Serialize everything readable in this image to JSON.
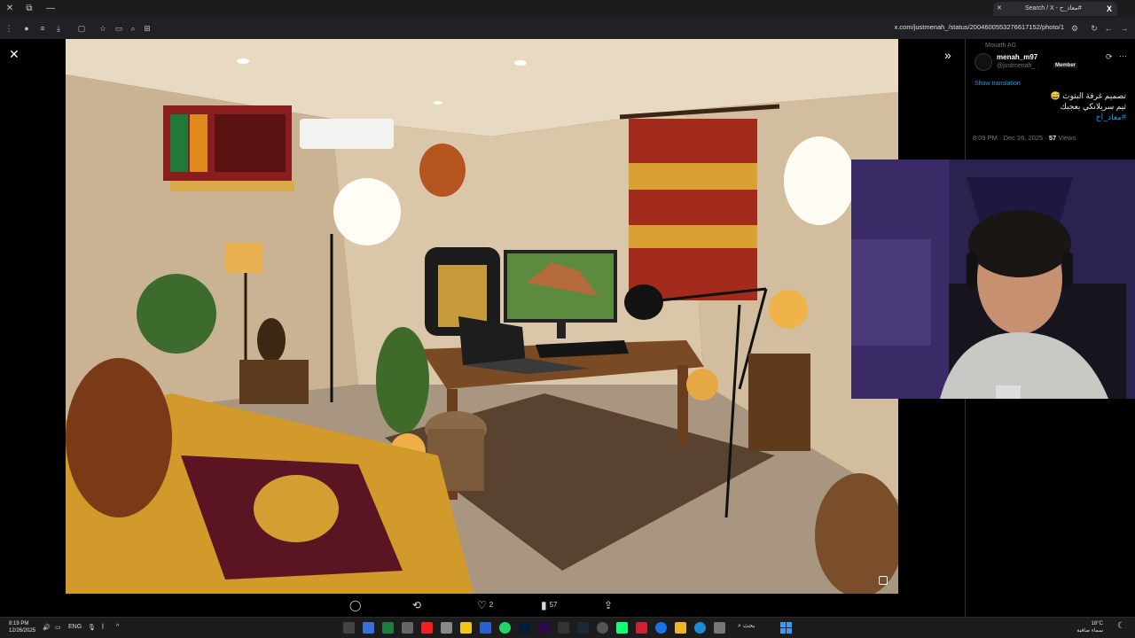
{
  "browser": {
    "tab_title": "Search / X - معاذ_ح#",
    "url": "x.com/justmenah_/status/2004600553276617152/photo/1"
  },
  "tweet": {
    "reposted_by": "Mouath AG",
    "user_name": "menah_m97",
    "handle": "@justmenah_ ·",
    "badge": "Member",
    "show_translation": "Show translation",
    "text_line1": "تصميم غرفة البثوث 😅",
    "text_line2": "ثيم سريلانكي يعجبك",
    "hashtag": "#معاذ_اح",
    "time": "8:09 PM · Dec 26, 2025 ·",
    "views_count": "57",
    "views_label": "Views"
  },
  "actions": {
    "likes": "2",
    "views": "57"
  },
  "taskbar": {
    "time": "8:19 PM",
    "date": "12/26/2025",
    "lang": "ENG",
    "search": "بحث",
    "temp": "18°C",
    "weather": "سماء صافية"
  },
  "colors": {
    "accent": "#1d9bf0",
    "background": "#000000"
  }
}
